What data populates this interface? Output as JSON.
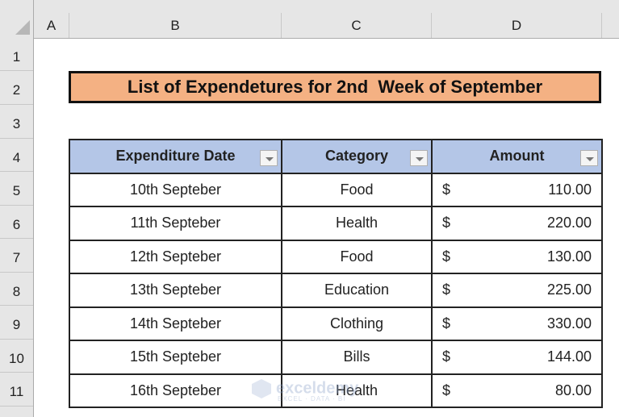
{
  "columns": [
    "A",
    "B",
    "C",
    "D"
  ],
  "rows": [
    "1",
    "2",
    "3",
    "4",
    "5",
    "6",
    "7",
    "8",
    "9",
    "10",
    "11"
  ],
  "title": "List of Expendetures for 2nd  Week of September",
  "table": {
    "headers": [
      "Expenditure Date",
      "Category",
      "Amount"
    ],
    "rows": [
      {
        "date": "10th Septeber",
        "category": "Food",
        "currency": "$",
        "amount": "110.00"
      },
      {
        "date": "11th Septeber",
        "category": "Health",
        "currency": "$",
        "amount": "220.00"
      },
      {
        "date": "12th Septeber",
        "category": "Food",
        "currency": "$",
        "amount": "130.00"
      },
      {
        "date": "13th Septeber",
        "category": "Education",
        "currency": "$",
        "amount": "225.00"
      },
      {
        "date": "14th Septeber",
        "category": "Clothing",
        "currency": "$",
        "amount": "330.00"
      },
      {
        "date": "15th Septeber",
        "category": "Bills",
        "currency": "$",
        "amount": "144.00"
      },
      {
        "date": "16th Septeber",
        "category": "Health",
        "currency": "$",
        "amount": "80.00"
      }
    ]
  },
  "watermark": {
    "name": "exceldemy",
    "tagline": "EXCEL · DATA · BI"
  },
  "colors": {
    "title_fill": "#f4b183",
    "header_fill": "#b4c6e7"
  }
}
